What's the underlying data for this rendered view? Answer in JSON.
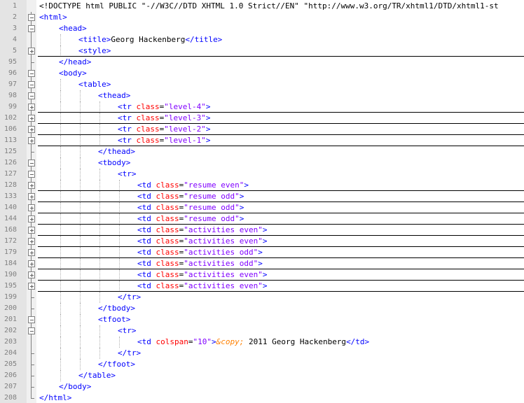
{
  "editor": {
    "lines": [
      {
        "number": "1",
        "indent": 0,
        "fold": "none",
        "folded": false,
        "tokens": [
          {
            "t": "<!DOCTYPE html PUBLIC \"-//W3C//DTD XHTML 1.0 Strict//EN\" \"http://www.w3.org/TR/xhtml1/DTD/xhtml1-st",
            "c": "black"
          }
        ]
      },
      {
        "number": "2",
        "indent": 0,
        "fold": "open",
        "folded": false,
        "tokens": [
          {
            "t": "<html>",
            "c": "blue"
          }
        ]
      },
      {
        "number": "3",
        "indent": 1,
        "fold": "open",
        "folded": false,
        "tokens": [
          {
            "t": "<head>",
            "c": "blue"
          }
        ]
      },
      {
        "number": "4",
        "indent": 2,
        "fold": "line",
        "folded": false,
        "tokens": [
          {
            "t": "<title>",
            "c": "blue"
          },
          {
            "t": "Georg Hackenberg",
            "c": "black"
          },
          {
            "t": "</title>",
            "c": "blue"
          }
        ]
      },
      {
        "number": "5",
        "indent": 2,
        "fold": "plus",
        "folded": true,
        "tokens": [
          {
            "t": "<style>",
            "c": "blue"
          }
        ]
      },
      {
        "number": "95",
        "indent": 1,
        "fold": "end",
        "folded": false,
        "tokens": [
          {
            "t": "</head>",
            "c": "blue"
          }
        ]
      },
      {
        "number": "96",
        "indent": 1,
        "fold": "open",
        "folded": false,
        "tokens": [
          {
            "t": "<body>",
            "c": "blue"
          }
        ]
      },
      {
        "number": "97",
        "indent": 2,
        "fold": "open",
        "folded": false,
        "tokens": [
          {
            "t": "<table>",
            "c": "blue"
          }
        ]
      },
      {
        "number": "98",
        "indent": 3,
        "fold": "open",
        "folded": false,
        "tokens": [
          {
            "t": "<thead>",
            "c": "blue"
          }
        ]
      },
      {
        "number": "99",
        "indent": 4,
        "fold": "plus",
        "folded": true,
        "tokens": [
          {
            "t": "<tr ",
            "c": "blue"
          },
          {
            "t": "class",
            "c": "red"
          },
          {
            "t": "=",
            "c": "black"
          },
          {
            "t": "\"level-4\"",
            "c": "purple"
          },
          {
            "t": ">",
            "c": "blue"
          }
        ]
      },
      {
        "number": "102",
        "indent": 4,
        "fold": "plus",
        "folded": true,
        "tokens": [
          {
            "t": "<tr ",
            "c": "blue"
          },
          {
            "t": "class",
            "c": "red"
          },
          {
            "t": "=",
            "c": "black"
          },
          {
            "t": "\"level-3\"",
            "c": "purple"
          },
          {
            "t": ">",
            "c": "blue"
          }
        ]
      },
      {
        "number": "106",
        "indent": 4,
        "fold": "plus",
        "folded": true,
        "tokens": [
          {
            "t": "<tr ",
            "c": "blue"
          },
          {
            "t": "class",
            "c": "red"
          },
          {
            "t": "=",
            "c": "black"
          },
          {
            "t": "\"level-2\"",
            "c": "purple"
          },
          {
            "t": ">",
            "c": "blue"
          }
        ]
      },
      {
        "number": "113",
        "indent": 4,
        "fold": "plus",
        "folded": true,
        "tokens": [
          {
            "t": "<tr ",
            "c": "blue"
          },
          {
            "t": "class",
            "c": "red"
          },
          {
            "t": "=",
            "c": "black"
          },
          {
            "t": "\"level-1\"",
            "c": "purple"
          },
          {
            "t": ">",
            "c": "blue"
          }
        ]
      },
      {
        "number": "125",
        "indent": 3,
        "fold": "end",
        "folded": false,
        "tokens": [
          {
            "t": "</thead>",
            "c": "blue"
          }
        ]
      },
      {
        "number": "126",
        "indent": 3,
        "fold": "open",
        "folded": false,
        "tokens": [
          {
            "t": "<tbody>",
            "c": "blue"
          }
        ]
      },
      {
        "number": "127",
        "indent": 4,
        "fold": "open",
        "folded": false,
        "tokens": [
          {
            "t": "<tr>",
            "c": "blue"
          }
        ]
      },
      {
        "number": "128",
        "indent": 5,
        "fold": "plus",
        "folded": true,
        "tokens": [
          {
            "t": "<td ",
            "c": "blue"
          },
          {
            "t": "class",
            "c": "red"
          },
          {
            "t": "=",
            "c": "black"
          },
          {
            "t": "\"resume even\"",
            "c": "purple"
          },
          {
            "t": ">",
            "c": "blue"
          }
        ]
      },
      {
        "number": "133",
        "indent": 5,
        "fold": "plus",
        "folded": true,
        "tokens": [
          {
            "t": "<td ",
            "c": "blue"
          },
          {
            "t": "class",
            "c": "red"
          },
          {
            "t": "=",
            "c": "black"
          },
          {
            "t": "\"resume odd\"",
            "c": "purple"
          },
          {
            "t": ">",
            "c": "blue"
          }
        ]
      },
      {
        "number": "140",
        "indent": 5,
        "fold": "plus",
        "folded": true,
        "tokens": [
          {
            "t": "<td ",
            "c": "blue"
          },
          {
            "t": "class",
            "c": "red"
          },
          {
            "t": "=",
            "c": "black"
          },
          {
            "t": "\"resume odd\"",
            "c": "purple"
          },
          {
            "t": ">",
            "c": "blue"
          }
        ]
      },
      {
        "number": "144",
        "indent": 5,
        "fold": "plus",
        "folded": true,
        "tokens": [
          {
            "t": "<td ",
            "c": "blue"
          },
          {
            "t": "class",
            "c": "red"
          },
          {
            "t": "=",
            "c": "black"
          },
          {
            "t": "\"resume odd\"",
            "c": "purple"
          },
          {
            "t": ">",
            "c": "blue"
          }
        ]
      },
      {
        "number": "168",
        "indent": 5,
        "fold": "plus",
        "folded": true,
        "tokens": [
          {
            "t": "<td ",
            "c": "blue"
          },
          {
            "t": "class",
            "c": "red"
          },
          {
            "t": "=",
            "c": "black"
          },
          {
            "t": "\"activities even\"",
            "c": "purple"
          },
          {
            "t": ">",
            "c": "blue"
          }
        ]
      },
      {
        "number": "172",
        "indent": 5,
        "fold": "plus",
        "folded": true,
        "tokens": [
          {
            "t": "<td ",
            "c": "blue"
          },
          {
            "t": "class",
            "c": "red"
          },
          {
            "t": "=",
            "c": "black"
          },
          {
            "t": "\"activities even\"",
            "c": "purple"
          },
          {
            "t": ">",
            "c": "blue"
          }
        ]
      },
      {
        "number": "179",
        "indent": 5,
        "fold": "plus",
        "folded": true,
        "tokens": [
          {
            "t": "<td ",
            "c": "blue"
          },
          {
            "t": "class",
            "c": "red"
          },
          {
            "t": "=",
            "c": "black"
          },
          {
            "t": "\"activities odd\"",
            "c": "purple"
          },
          {
            "t": ">",
            "c": "blue"
          }
        ]
      },
      {
        "number": "184",
        "indent": 5,
        "fold": "plus",
        "folded": true,
        "tokens": [
          {
            "t": "<td ",
            "c": "blue"
          },
          {
            "t": "class",
            "c": "red"
          },
          {
            "t": "=",
            "c": "black"
          },
          {
            "t": "\"activities odd\"",
            "c": "purple"
          },
          {
            "t": ">",
            "c": "blue"
          }
        ]
      },
      {
        "number": "190",
        "indent": 5,
        "fold": "plus",
        "folded": true,
        "tokens": [
          {
            "t": "<td ",
            "c": "blue"
          },
          {
            "t": "class",
            "c": "red"
          },
          {
            "t": "=",
            "c": "black"
          },
          {
            "t": "\"activities even\"",
            "c": "purple"
          },
          {
            "t": ">",
            "c": "blue"
          }
        ]
      },
      {
        "number": "195",
        "indent": 5,
        "fold": "plus",
        "folded": true,
        "tokens": [
          {
            "t": "<td ",
            "c": "blue"
          },
          {
            "t": "class",
            "c": "red"
          },
          {
            "t": "=",
            "c": "black"
          },
          {
            "t": "\"activities even\"",
            "c": "purple"
          },
          {
            "t": ">",
            "c": "blue"
          }
        ]
      },
      {
        "number": "199",
        "indent": 4,
        "fold": "end",
        "folded": false,
        "tokens": [
          {
            "t": "</tr>",
            "c": "blue"
          }
        ]
      },
      {
        "number": "200",
        "indent": 3,
        "fold": "end",
        "folded": false,
        "tokens": [
          {
            "t": "</tbody>",
            "c": "blue"
          }
        ]
      },
      {
        "number": "201",
        "indent": 3,
        "fold": "open",
        "folded": false,
        "tokens": [
          {
            "t": "<tfoot>",
            "c": "blue"
          }
        ]
      },
      {
        "number": "202",
        "indent": 4,
        "fold": "open",
        "folded": false,
        "tokens": [
          {
            "t": "<tr>",
            "c": "blue"
          }
        ]
      },
      {
        "number": "203",
        "indent": 5,
        "fold": "line",
        "folded": false,
        "tokens": [
          {
            "t": "<td ",
            "c": "blue"
          },
          {
            "t": "colspan",
            "c": "red"
          },
          {
            "t": "=",
            "c": "black"
          },
          {
            "t": "\"10\"",
            "c": "purple"
          },
          {
            "t": ">",
            "c": "blue"
          },
          {
            "t": "&copy;",
            "c": "entity"
          },
          {
            "t": " 2011 Georg Hackenberg",
            "c": "black"
          },
          {
            "t": "</td>",
            "c": "blue"
          }
        ]
      },
      {
        "number": "204",
        "indent": 4,
        "fold": "end",
        "folded": false,
        "tokens": [
          {
            "t": "</tr>",
            "c": "blue"
          }
        ]
      },
      {
        "number": "205",
        "indent": 3,
        "fold": "end",
        "folded": false,
        "tokens": [
          {
            "t": "</tfoot>",
            "c": "blue"
          }
        ]
      },
      {
        "number": "206",
        "indent": 2,
        "fold": "end",
        "folded": false,
        "tokens": [
          {
            "t": "</table>",
            "c": "blue"
          }
        ]
      },
      {
        "number": "207",
        "indent": 1,
        "fold": "end",
        "folded": false,
        "tokens": [
          {
            "t": "</body>",
            "c": "blue"
          }
        ]
      },
      {
        "number": "208",
        "indent": 0,
        "fold": "last",
        "folded": false,
        "tokens": [
          {
            "t": "</html>",
            "c": "blue"
          }
        ]
      }
    ]
  }
}
